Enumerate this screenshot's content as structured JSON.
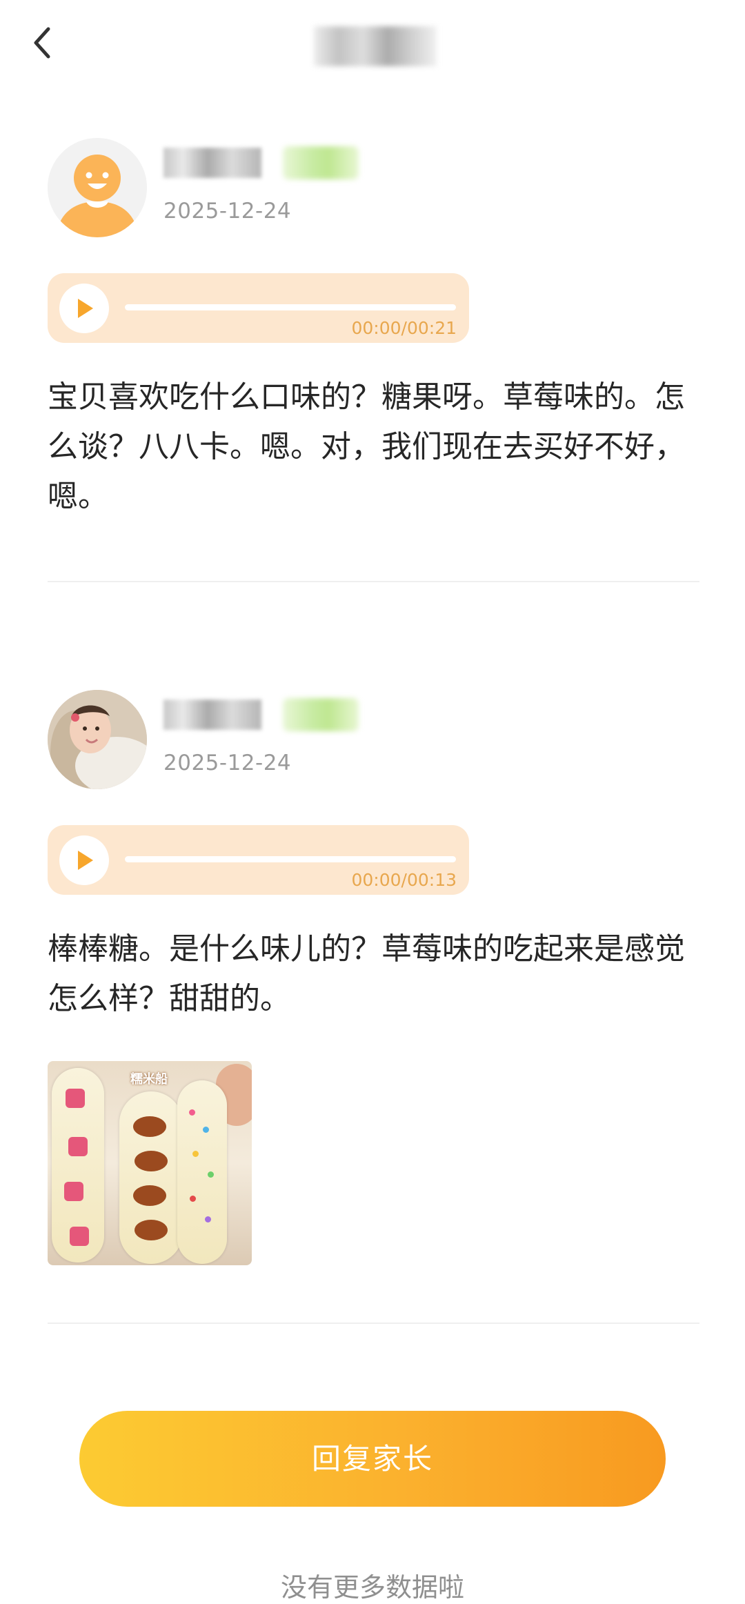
{
  "header": {
    "back_icon": "chevron-left-icon",
    "title": ""
  },
  "posts": [
    {
      "avatar": "default-avatar",
      "date": "2025-12-24",
      "audio": {
        "time": "00:00/00:21",
        "progress": 0
      },
      "text": "宝贝喜欢吃什么口味的？糖果呀。草莓味的。怎么谈？八八卡。嗯。对，我们现在去买好不好，嗯。"
    },
    {
      "avatar": "photo-avatar",
      "date": "2025-12-24",
      "audio": {
        "time": "00:00/00:13",
        "progress": 0
      },
      "text": "棒棒糖。是什么味儿的？草莓味的吃起来是感觉怎么样？甜甜的。",
      "image_caption": "糯米船"
    }
  ],
  "reply_button": "回复家长",
  "footer_note": "没有更多数据啦",
  "colors": {
    "accent": "#f7a62c",
    "audio_bg": "#fde7cf",
    "button_gradient_start": "#fccb32",
    "button_gradient_end": "#f89a20"
  }
}
